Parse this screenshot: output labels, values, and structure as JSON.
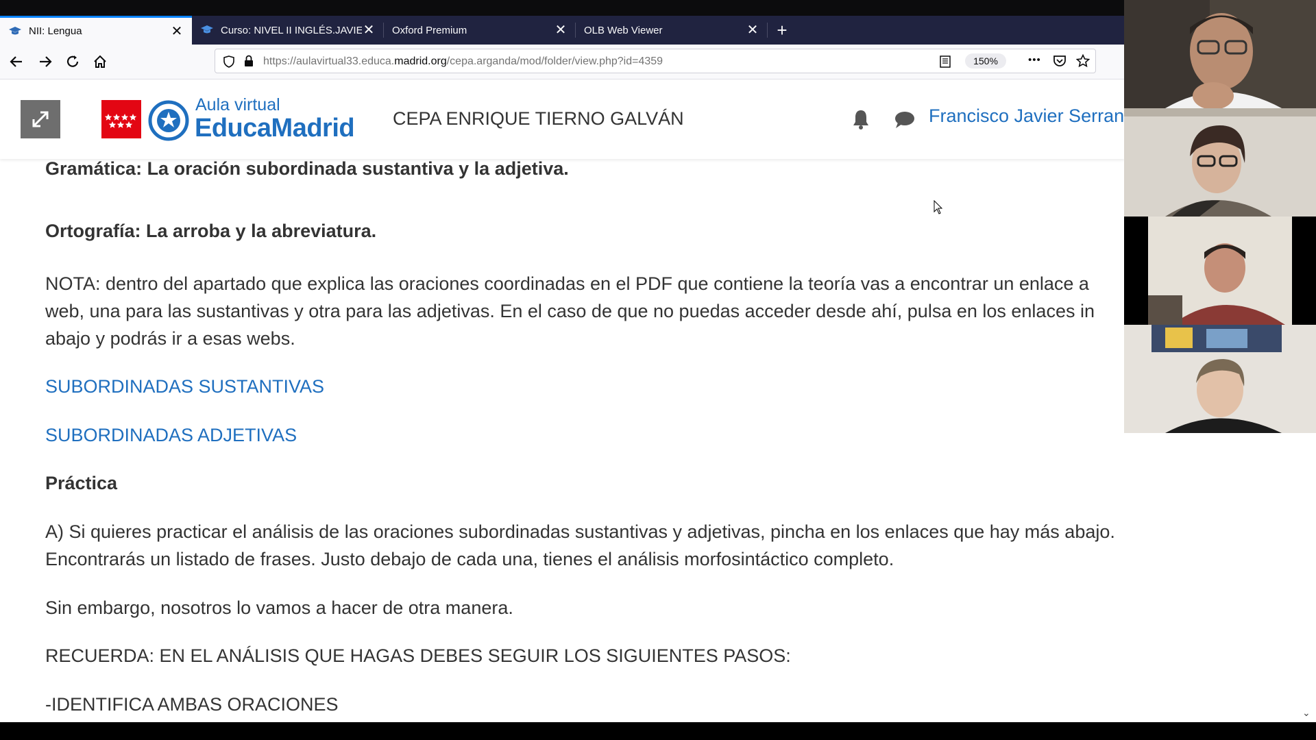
{
  "browser": {
    "tabs": [
      {
        "title": "NII: Lengua",
        "active": true
      },
      {
        "title": "Curso: NIVEL II INGLÉS.JAVIER",
        "active": false
      },
      {
        "title": "Oxford Premium",
        "active": false
      },
      {
        "title": "OLB Web Viewer",
        "active": false
      }
    ],
    "new_tab_label": "+",
    "close_label": "✕",
    "url_prefix": "https://aulavirtual33.educa.",
    "url_host": "madrid.org",
    "url_path": "/cepa.arganda/mod/folder/view.php?id=4359",
    "zoom": "150%",
    "more_label": "•••"
  },
  "site": {
    "logo_line1": "Aula virtual",
    "logo_line2": "EducaMadrid",
    "school_name": "CEPA ENRIQUE TIERNO GALVÁN",
    "user_name": "Francisco Javier Serran"
  },
  "content": {
    "grammar_heading": "Gramática: La oración subordinada sustantiva y la adjetiva.",
    "spelling_heading": "Ortografía: La arroba y la abreviatura.",
    "note_line1": "NOTA: dentro del apartado que explica las oraciones coordinadas en el PDF que contiene la teoría vas a encontrar un enlace a",
    "note_line2": "web, una para las sustantivas y otra para las adjetivas. En el caso de que no puedas acceder desde ahí, pulsa en los enlaces in",
    "note_line3": "abajo y podrás ir a esas webs.",
    "link_sustantivas": "SUBORDINADAS SUSTANTIVAS",
    "link_adjetivas": "SUBORDINADAS ADJETIVAS",
    "practice_heading": "Práctica",
    "practice_a_line1": "A) Si quieres practicar el análisis de las oraciones subordinadas sustantivas y adjetivas, pincha en los enlaces que hay más abajo.",
    "practice_a_line2": "Encontrarás un listado de frases. Justo debajo de cada una, tienes el análisis morfosintáctico completo.",
    "however": "Sin embargo, nosotros lo vamos a hacer de otra manera.",
    "remember": "RECUERDA: EN EL ANÁLISIS QUE HAGAS DEBES SEGUIR LOS SIGUIENTES PASOS:",
    "step1": "-IDENTIFICA AMBAS ORACIONES"
  },
  "colors": {
    "link": "#1f6fbf",
    "accent_tab": "#0a84ff",
    "logo_red": "#e30613",
    "tabstrip": "#202340"
  }
}
